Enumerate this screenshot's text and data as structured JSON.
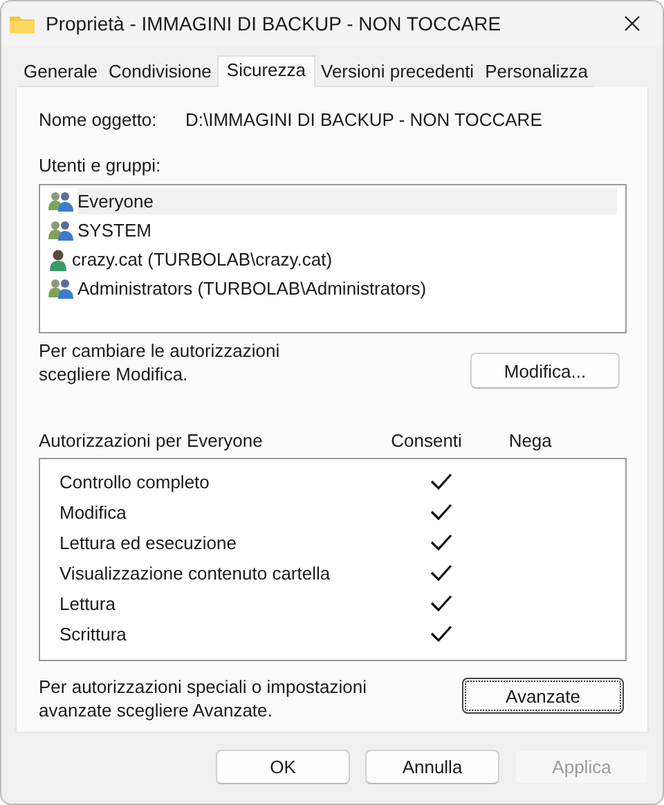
{
  "window": {
    "title": "Proprietà - IMMAGINI DI BACKUP - NON TOCCARE"
  },
  "tabs": [
    {
      "label": "Generale",
      "selected": false
    },
    {
      "label": "Condivisione",
      "selected": false
    },
    {
      "label": "Sicurezza",
      "selected": true
    },
    {
      "label": "Versioni precedenti",
      "selected": false
    },
    {
      "label": "Personalizza",
      "selected": false
    }
  ],
  "object_name": {
    "label": "Nome oggetto:",
    "value": "D:\\IMMAGINI DI BACKUP - NON TOCCARE"
  },
  "users": {
    "label": "Utenti e gruppi:",
    "items": [
      {
        "name": "Everyone",
        "kind": "group",
        "selected": true
      },
      {
        "name": "SYSTEM",
        "kind": "group",
        "selected": false
      },
      {
        "name": "crazy.cat (TURBOLAB\\crazy.cat)",
        "kind": "user",
        "selected": false
      },
      {
        "name": "Administrators (TURBOLAB\\Administrators)",
        "kind": "group",
        "selected": false
      }
    ]
  },
  "change_hint": "Per cambiare le autorizzazioni scegliere Modifica.",
  "edit_button": {
    "label": "Modifica..."
  },
  "permissions": {
    "title": "Autorizzazioni per Everyone",
    "columns": [
      "Consenti",
      "Nega"
    ],
    "rows": [
      {
        "name": "Controllo completo",
        "allow": true,
        "deny": false
      },
      {
        "name": "Modifica",
        "allow": true,
        "deny": false
      },
      {
        "name": "Lettura ed esecuzione",
        "allow": true,
        "deny": false
      },
      {
        "name": "Visualizzazione contenuto cartella",
        "allow": true,
        "deny": false
      },
      {
        "name": "Lettura",
        "allow": true,
        "deny": false
      },
      {
        "name": "Scrittura",
        "allow": true,
        "deny": false
      }
    ]
  },
  "advanced_hint": "Per autorizzazioni speciali o impostazioni avanzate scegliere Avanzate.",
  "advanced_button": {
    "label": "Avanzate",
    "focused": true
  },
  "buttons": [
    {
      "label": "OK",
      "disabled": false
    },
    {
      "label": "Annulla",
      "disabled": false
    },
    {
      "label": "Applica",
      "disabled": true
    }
  ]
}
